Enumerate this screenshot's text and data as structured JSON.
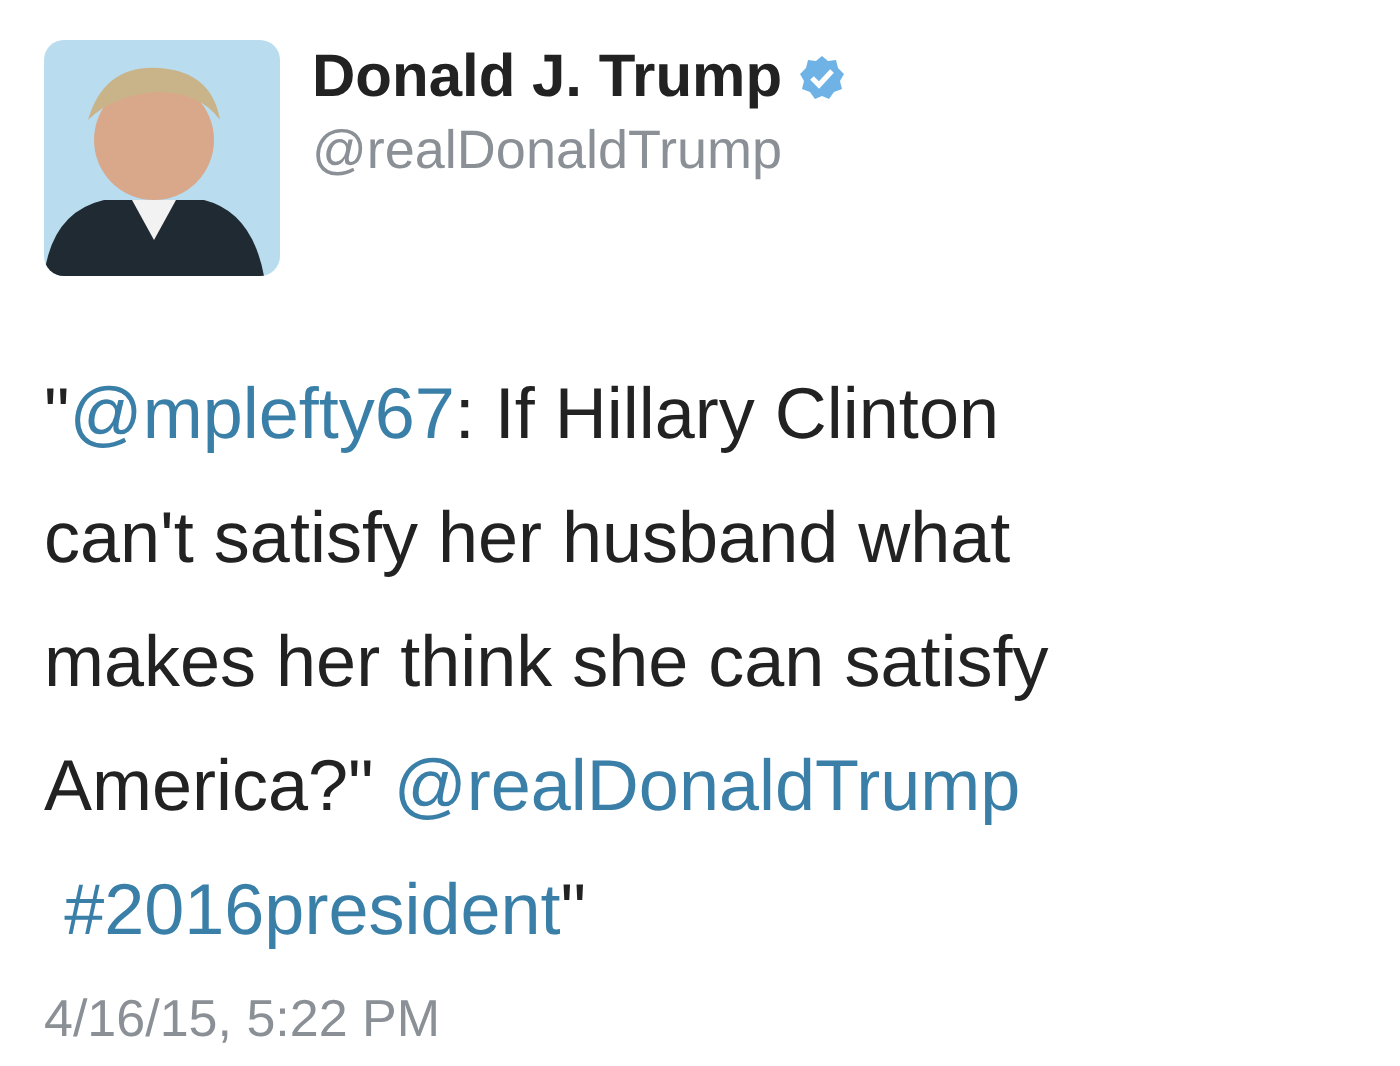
{
  "author": {
    "name": "Donald J. Trump",
    "verified": true,
    "handle": "@realDonaldTrump"
  },
  "tweet": {
    "segments": [
      {
        "kind": "text",
        "text": "\""
      },
      {
        "kind": "mention",
        "text": "@mplefty67"
      },
      {
        "kind": "text",
        "text": ":  If Hillary Clinton can't satisfy her husband what makes her think she can satisfy America?\" "
      },
      {
        "kind": "mention",
        "text": "@realDonaldTrump"
      },
      {
        "kind": "hashtag",
        "text": "#2016president"
      },
      {
        "kind": "text",
        "text": "\""
      }
    ],
    "timestamp": "4/16/15, 5:22 PM"
  }
}
